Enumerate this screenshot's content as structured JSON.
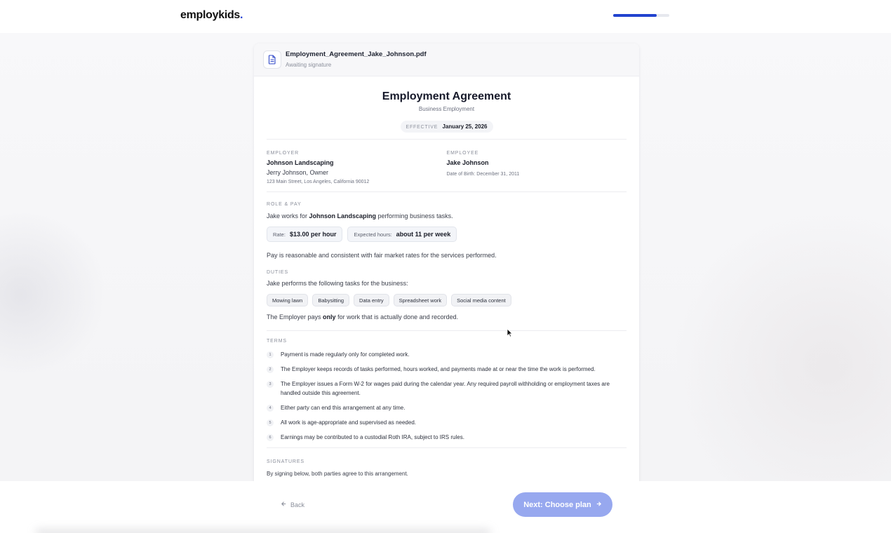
{
  "app": {
    "logo_text": "employkids",
    "logo_dot": ".",
    "brand_color": "#2243cf",
    "progress_fraction": 0.78
  },
  "file": {
    "name": "Employment_Agreement_Jake_Johnson.pdf",
    "status": "Awaiting signature",
    "icon": "document-icon"
  },
  "document": {
    "title": "Employment Agreement",
    "subtitle": "Business Employment",
    "effective_label": "EFFECTIVE",
    "effective_date": "January 25, 2026",
    "employer": {
      "label": "EMPLOYER",
      "name": "Johnson Landscaping",
      "contact": "Jerry Johnson, Owner",
      "address": "123 Main Street, Los Angeles, California 90012"
    },
    "employee": {
      "label": "EMPLOYEE",
      "name": "Jake Johnson",
      "dob": "Date of Birth: December 31, 2011"
    },
    "role_pay": {
      "label": "ROLE & PAY",
      "intro_pre": "Jake works for ",
      "intro_company": "Johnson Landscaping",
      "intro_post": " performing business tasks.",
      "rate_label": "Rate:",
      "rate_value": "$13.00 per hour",
      "hours_label": "Expected hours:",
      "hours_value": "about 11 per week",
      "note": "Pay is reasonable and consistent with fair market rates for the services performed."
    },
    "duties": {
      "label": "DUTIES",
      "intro": "Jake performs the following tasks for the business:",
      "tags": [
        "Mowing lawn",
        "Babysitting",
        "Data entry",
        "Spreadsheet work",
        "Social media content"
      ],
      "note_pre": "The Employer pays ",
      "note_bold": "only",
      "note_post": " for work that is actually done and recorded."
    },
    "terms": {
      "label": "TERMS",
      "items": [
        {
          "num": "1",
          "text": "Payment is made regularly only for completed work."
        },
        {
          "num": "2",
          "text": "The Employer keeps records of tasks performed, hours worked, and payments made at or near the time the work is performed."
        },
        {
          "num": "3",
          "text": "The Employer issues a Form W-2 for wages paid during the calendar year. Any required payroll withholding or employment taxes are handled outside this agreement."
        },
        {
          "num": "4",
          "text": "Either party can end this arrangement at any time."
        },
        {
          "num": "5",
          "text": "All work is age-appropriate and supervised as needed."
        },
        {
          "num": "6",
          "text": "Earnings may be contributed to a custodial Roth IRA, subject to IRS rules."
        }
      ]
    },
    "signatures": {
      "label": "SIGNATURES",
      "intro": "By signing below, both parties agree to this arrangement."
    }
  },
  "footer": {
    "back_label": "Back",
    "next_label": "Next: Choose plan"
  }
}
